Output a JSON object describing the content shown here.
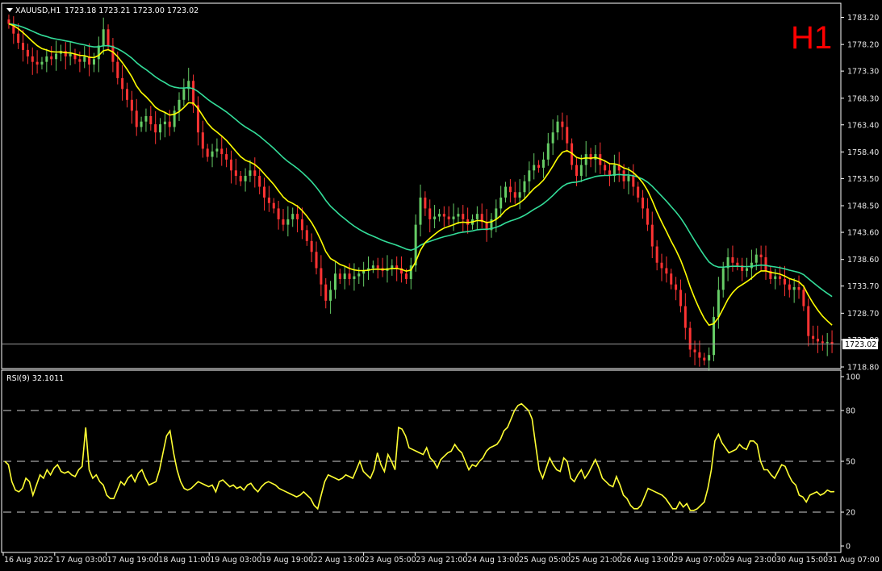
{
  "colors": {
    "background": "#000000",
    "frame": "#ffffff",
    "bull_candle": "#66cc66",
    "bear_candle": "#ff3333",
    "ma_fast": "#ffff00",
    "ma_slow": "#33dd99",
    "rsi_line": "#ffff33",
    "text": "#e6e6e6",
    "timeframe_label": "#ff0000"
  },
  "header": {
    "menu_icon": "triangle-down-icon",
    "symbol": "XAUUSD,H1",
    "ohlc": "1723.18 1723.21 1723.00 1723.02"
  },
  "timeframe_label": "H1",
  "chart_data": [
    {
      "type": "candlestick",
      "title": "XAUUSD,H1",
      "ylim": [
        1718.8,
        1785.5
      ],
      "y_ticks": [
        "1783.20",
        "1778.20",
        "1773.30",
        "1768.30",
        "1763.40",
        "1758.40",
        "1753.50",
        "1748.50",
        "1743.60",
        "1738.60",
        "1733.70",
        "1728.70",
        "1723.80",
        "1718.80"
      ],
      "current_price": "1723.02",
      "close": [
        1782.0,
        1780.2,
        1778.5,
        1777.2,
        1776.0,
        1775.0,
        1774.5,
        1775.0,
        1776.0,
        1775.5,
        1776.5,
        1777.0,
        1776.0,
        1776.5,
        1775.5,
        1775.0,
        1776.0,
        1774.5,
        1775.5,
        1778.0,
        1781.0,
        1778.0,
        1775.0,
        1772.0,
        1770.0,
        1768.0,
        1766.0,
        1763.0,
        1764.0,
        1765.0,
        1763.5,
        1762.0,
        1763.5,
        1764.0,
        1763.0,
        1766.0,
        1768.0,
        1770.0,
        1771.5,
        1767.0,
        1762.0,
        1759.0,
        1757.5,
        1758.5,
        1759.0,
        1758.0,
        1757.0,
        1755.0,
        1754.0,
        1753.0,
        1754.0,
        1755.0,
        1754.0,
        1752.0,
        1750.0,
        1749.0,
        1748.0,
        1746.0,
        1745.0,
        1746.0,
        1747.0,
        1746.0,
        1744.0,
        1742.0,
        1740.0,
        1737.0,
        1734.0,
        1731.0,
        1733.0,
        1736.0,
        1735.0,
        1736.0,
        1735.0,
        1735.5,
        1736.0,
        1736.5,
        1737.0,
        1737.5,
        1737.0,
        1736.5,
        1737.0,
        1737.5,
        1737.0,
        1736.0,
        1735.0,
        1737.5,
        1745.0,
        1750.0,
        1748.0,
        1746.0,
        1746.5,
        1747.0,
        1746.5,
        1746.0,
        1746.5,
        1747.0,
        1746.0,
        1745.0,
        1746.0,
        1747.0,
        1745.5,
        1744.0,
        1746.0,
        1748.0,
        1750.0,
        1752.0,
        1751.0,
        1750.0,
        1751.0,
        1753.0,
        1755.0,
        1756.0,
        1755.5,
        1757.0,
        1760.0,
        1762.0,
        1764.0,
        1763.0,
        1760.0,
        1756.0,
        1754.0,
        1756.0,
        1758.0,
        1757.0,
        1758.0,
        1756.0,
        1755.0,
        1754.0,
        1756.0,
        1755.0,
        1753.0,
        1754.0,
        1752.0,
        1750.0,
        1748.0,
        1745.0,
        1741.0,
        1738.0,
        1737.0,
        1736.0,
        1734.0,
        1733.0,
        1730.0,
        1726.0,
        1722.0,
        1721.5,
        1720.5,
        1720.0,
        1721.0,
        1728.0,
        1733.0,
        1737.0,
        1739.0,
        1738.0,
        1737.5,
        1736.5,
        1737.0,
        1738.0,
        1739.5,
        1739.0,
        1736.5,
        1735.0,
        1735.5,
        1735.0,
        1734.0,
        1733.0,
        1733.5,
        1733.0,
        1730.0,
        1724.5,
        1724.0,
        1723.5,
        1723.2,
        1723.4,
        1723.0
      ]
    },
    {
      "type": "line",
      "title": "RSI(9) 32.1011",
      "ylim": [
        0,
        100
      ],
      "y_ticks": [
        "100",
        "80",
        "50",
        "20",
        "0"
      ],
      "levels": [
        80,
        50,
        20
      ],
      "values": [
        50,
        48,
        38,
        33,
        32,
        34,
        40,
        38,
        30,
        36,
        42,
        40,
        45,
        42,
        46,
        48,
        44,
        43,
        44,
        42,
        41,
        45,
        47,
        70,
        45,
        40,
        42,
        38,
        36,
        30,
        28,
        28,
        33,
        38,
        36,
        40,
        42,
        38,
        43,
        45,
        40,
        36,
        37,
        38,
        45,
        55,
        65,
        68,
        55,
        45,
        38,
        34,
        33,
        34,
        36,
        38,
        37,
        36,
        35,
        36,
        32,
        38,
        39,
        37,
        35,
        36,
        34,
        35,
        33,
        36,
        37,
        34,
        32,
        35,
        37,
        38,
        37,
        36,
        34,
        33,
        32,
        31,
        30,
        29,
        30,
        32,
        30,
        28,
        24,
        22,
        30,
        38,
        42,
        41,
        40,
        39,
        40,
        42,
        41,
        40,
        45,
        50,
        44,
        42,
        40,
        45,
        55,
        48,
        44,
        54,
        50,
        45,
        70,
        69,
        65,
        58,
        57,
        56,
        55,
        54,
        58,
        52,
        50,
        46,
        51,
        53,
        55,
        56,
        60,
        57,
        55,
        50,
        45,
        48,
        47,
        50,
        52,
        56,
        58,
        59,
        60,
        63,
        68,
        70,
        75,
        80,
        83,
        84,
        82,
        80,
        75,
        60,
        45,
        40,
        46,
        52,
        48,
        45,
        44,
        52,
        50,
        40,
        38,
        42,
        45,
        40,
        43,
        47,
        51,
        46,
        40,
        38,
        36,
        35,
        41,
        36,
        30,
        28,
        24,
        22,
        22,
        24,
        29,
        34,
        33,
        32,
        31,
        30,
        28,
        25,
        22,
        22,
        26,
        23,
        25,
        21,
        21,
        22,
        24,
        26,
        34,
        45,
        62,
        66,
        61,
        58,
        55,
        56,
        57,
        60,
        58,
        57,
        62,
        62,
        60,
        50,
        45,
        45,
        42,
        40,
        44,
        48,
        47,
        42,
        38,
        36,
        30,
        29,
        26,
        30,
        31,
        32,
        30,
        31,
        33,
        32,
        32.1
      ]
    }
  ],
  "x_axis": {
    "labels": [
      "16 Aug 2022",
      "17 Aug 03:00",
      "17 Aug 19:00",
      "18 Aug 11:00",
      "19 Aug 03:00",
      "19 Aug 19:00",
      "22 Aug 13:00",
      "23 Aug 05:00",
      "23 Aug 21:00",
      "24 Aug 13:00",
      "25 Aug 05:00",
      "25 Aug 21:00",
      "26 Aug 13:00",
      "29 Aug 07:00",
      "29 Aug 23:00",
      "30 Aug 15:00",
      "31 Aug 07:00"
    ]
  }
}
